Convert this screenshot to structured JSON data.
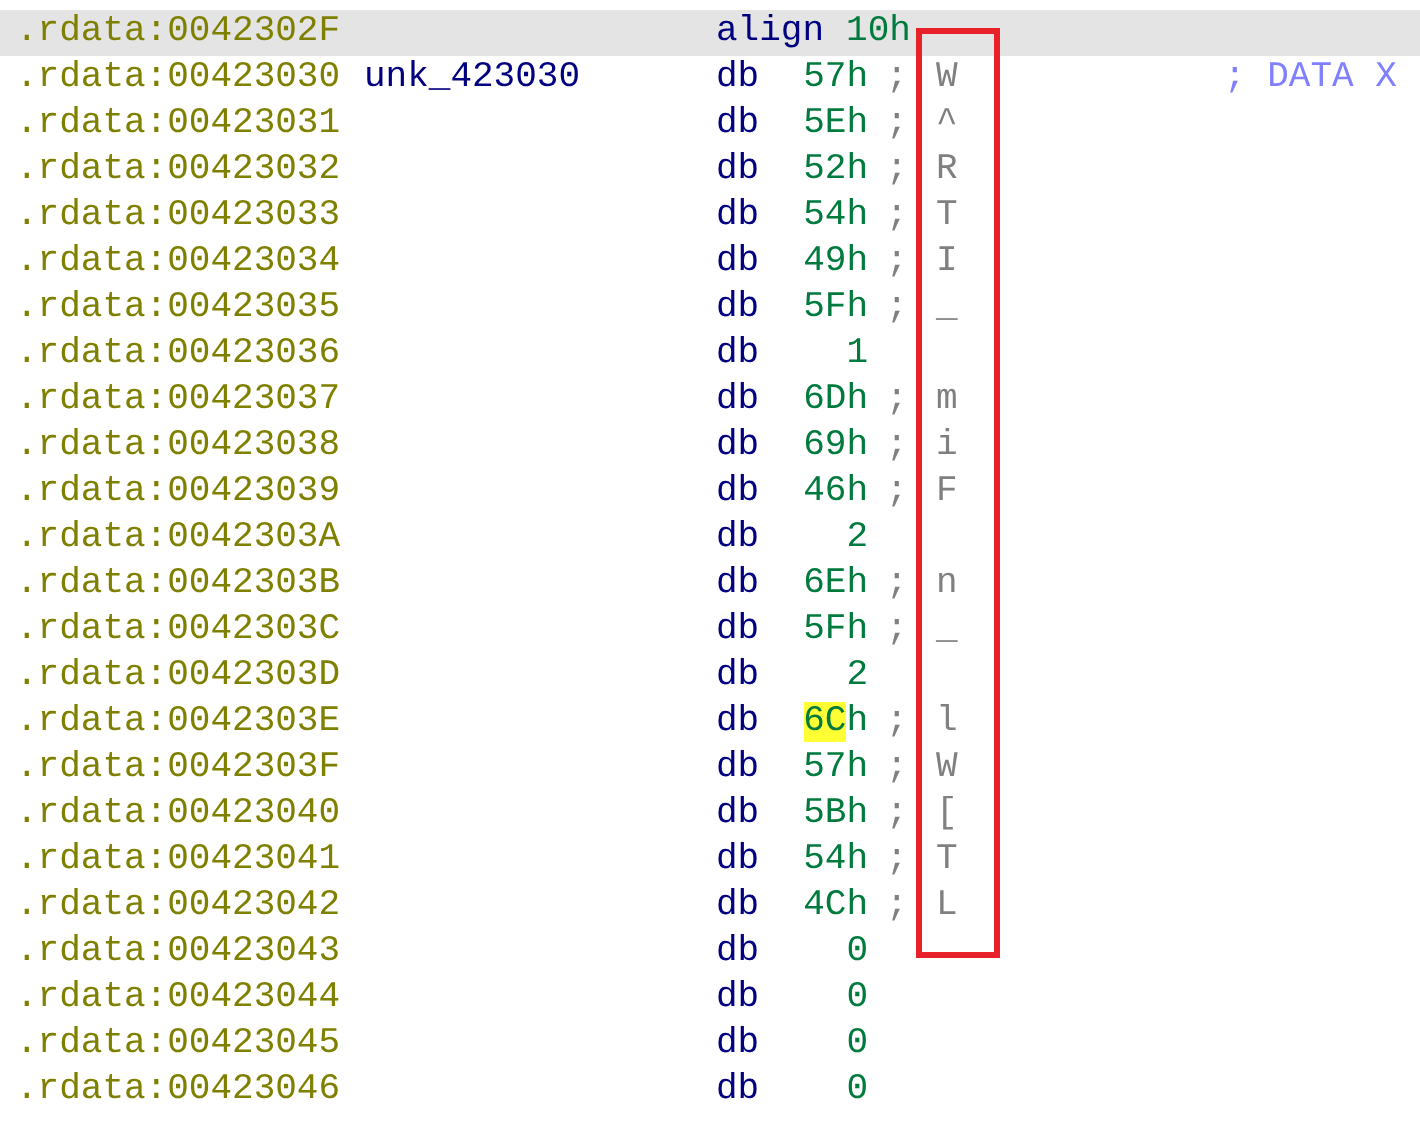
{
  "listing": [
    {
      "address": ".rdata:0042302F",
      "kind": "align",
      "mnemonic": "align",
      "operand": [
        {
          "text": "10h",
          "highlighted": false
        }
      ],
      "selected": true
    },
    {
      "address": ".rdata:00423030",
      "label": "unk_423030",
      "kind": "db",
      "mnemonic": "db",
      "operand": [
        {
          "text": "57h",
          "highlighted": false
        }
      ],
      "separator": ";",
      "char": "W",
      "xref": "; DATA X",
      "selected": false
    },
    {
      "address": ".rdata:00423031",
      "kind": "db",
      "mnemonic": "db",
      "operand": [
        {
          "text": "5Eh",
          "highlighted": false
        }
      ],
      "separator": ";",
      "char": "^",
      "selected": false
    },
    {
      "address": ".rdata:00423032",
      "kind": "db",
      "mnemonic": "db",
      "operand": [
        {
          "text": "52h",
          "highlighted": false
        }
      ],
      "separator": ";",
      "char": "R",
      "selected": false
    },
    {
      "address": ".rdata:00423033",
      "kind": "db",
      "mnemonic": "db",
      "operand": [
        {
          "text": "54h",
          "highlighted": false
        }
      ],
      "separator": ";",
      "char": "T",
      "selected": false
    },
    {
      "address": ".rdata:00423034",
      "kind": "db",
      "mnemonic": "db",
      "operand": [
        {
          "text": "49h",
          "highlighted": false
        }
      ],
      "separator": ";",
      "char": "I",
      "selected": false
    },
    {
      "address": ".rdata:00423035",
      "kind": "db",
      "mnemonic": "db",
      "operand": [
        {
          "text": "5Fh",
          "highlighted": false
        }
      ],
      "separator": ";",
      "char": "_",
      "selected": false
    },
    {
      "address": ".rdata:00423036",
      "kind": "db",
      "mnemonic": "db",
      "operand": [
        {
          "text": "1",
          "highlighted": false
        }
      ],
      "selected": false
    },
    {
      "address": ".rdata:00423037",
      "kind": "db",
      "mnemonic": "db",
      "operand": [
        {
          "text": "6Dh",
          "highlighted": false
        }
      ],
      "separator": ";",
      "char": "m",
      "selected": false
    },
    {
      "address": ".rdata:00423038",
      "kind": "db",
      "mnemonic": "db",
      "operand": [
        {
          "text": "69h",
          "highlighted": false
        }
      ],
      "separator": ";",
      "char": "i",
      "selected": false
    },
    {
      "address": ".rdata:00423039",
      "kind": "db",
      "mnemonic": "db",
      "operand": [
        {
          "text": "46h",
          "highlighted": false
        }
      ],
      "separator": ";",
      "char": "F",
      "selected": false
    },
    {
      "address": ".rdata:0042303A",
      "kind": "db",
      "mnemonic": "db",
      "operand": [
        {
          "text": "2",
          "highlighted": false
        }
      ],
      "selected": false
    },
    {
      "address": ".rdata:0042303B",
      "kind": "db",
      "mnemonic": "db",
      "operand": [
        {
          "text": "6Eh",
          "highlighted": false
        }
      ],
      "separator": ";",
      "char": "n",
      "selected": false
    },
    {
      "address": ".rdata:0042303C",
      "kind": "db",
      "mnemonic": "db",
      "operand": [
        {
          "text": "5Fh",
          "highlighted": false
        }
      ],
      "separator": ";",
      "char": "_",
      "selected": false
    },
    {
      "address": ".rdata:0042303D",
      "kind": "db",
      "mnemonic": "db",
      "operand": [
        {
          "text": "2",
          "highlighted": false
        }
      ],
      "selected": false
    },
    {
      "address": ".rdata:0042303E",
      "kind": "db",
      "mnemonic": "db",
      "operand": [
        {
          "text": "6C",
          "highlighted": true
        },
        {
          "text": "h",
          "highlighted": false
        }
      ],
      "separator": ";",
      "char": "l",
      "selected": false
    },
    {
      "address": ".rdata:0042303F",
      "kind": "db",
      "mnemonic": "db",
      "operand": [
        {
          "text": "57h",
          "highlighted": false
        }
      ],
      "separator": ";",
      "char": "W",
      "selected": false
    },
    {
      "address": ".rdata:00423040",
      "kind": "db",
      "mnemonic": "db",
      "operand": [
        {
          "text": "5Bh",
          "highlighted": false
        }
      ],
      "separator": ";",
      "char": "[",
      "selected": false
    },
    {
      "address": ".rdata:00423041",
      "kind": "db",
      "mnemonic": "db",
      "operand": [
        {
          "text": "54h",
          "highlighted": false
        }
      ],
      "separator": ";",
      "char": "T",
      "selected": false
    },
    {
      "address": ".rdata:00423042",
      "kind": "db",
      "mnemonic": "db",
      "operand": [
        {
          "text": "4Ch",
          "highlighted": false
        }
      ],
      "separator": ";",
      "char": "L",
      "selected": false
    },
    {
      "address": ".rdata:00423043",
      "kind": "db",
      "mnemonic": "db",
      "operand": [
        {
          "text": "0",
          "highlighted": false
        }
      ],
      "selected": false
    },
    {
      "address": ".rdata:00423044",
      "kind": "db",
      "mnemonic": "db",
      "operand": [
        {
          "text": "0",
          "highlighted": false
        }
      ],
      "selected": false
    },
    {
      "address": ".rdata:00423045",
      "kind": "db",
      "mnemonic": "db",
      "operand": [
        {
          "text": "0",
          "highlighted": false
        }
      ],
      "selected": false
    },
    {
      "address": ".rdata:00423046",
      "kind": "db",
      "mnemonic": "db",
      "operand": [
        {
          "text": "0",
          "highlighted": false
        }
      ],
      "selected": false
    }
  ],
  "annotation": {
    "kind": "frame",
    "color": "#e8202a"
  }
}
